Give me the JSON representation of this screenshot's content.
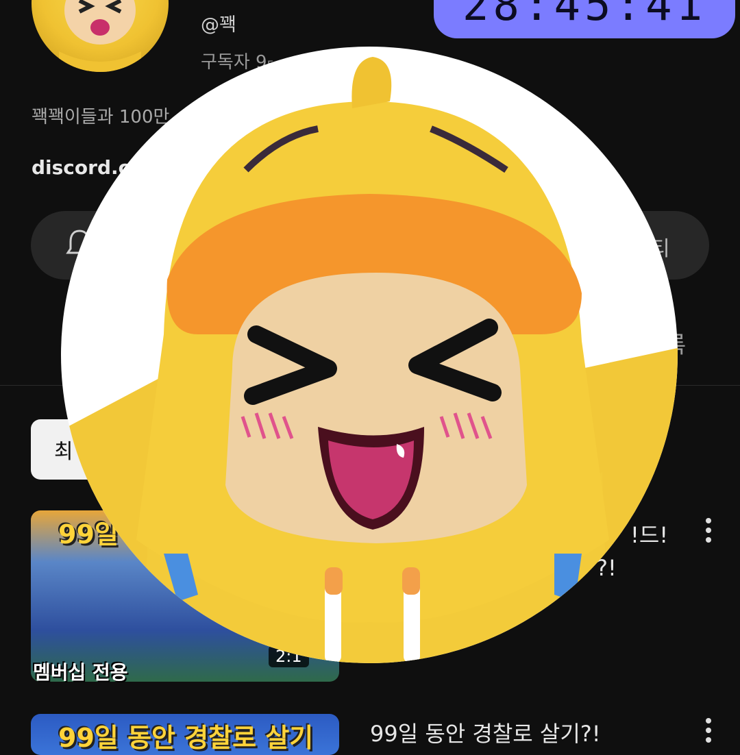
{
  "channel": {
    "handle": "@꽥",
    "subs_line": "구독자 9₅ ·  ·   789개",
    "description": "꽥꽥이들과 100만",
    "link": "discord.c",
    "avatar_icon": "duck-avatar-icon"
  },
  "timer": {
    "text": "28:45:41",
    "color": "#7b7cff"
  },
  "actions": {
    "join_label": "티",
    "more_label": "록"
  },
  "filters": {
    "latest_label": "최"
  },
  "videos": [
    {
      "thumb_title": "99일",
      "badge": "멤버십 전용",
      "duration": "2:1",
      "title_line1": "!드!",
      "title_line2": "?!"
    },
    {
      "thumb_title": "99일 동안 경찰로 살기",
      "title_line1": "99일 동안 경찰로 살기?!"
    }
  ],
  "overlay": {
    "icon": "duck-character-icon",
    "background": "#ffffff"
  }
}
